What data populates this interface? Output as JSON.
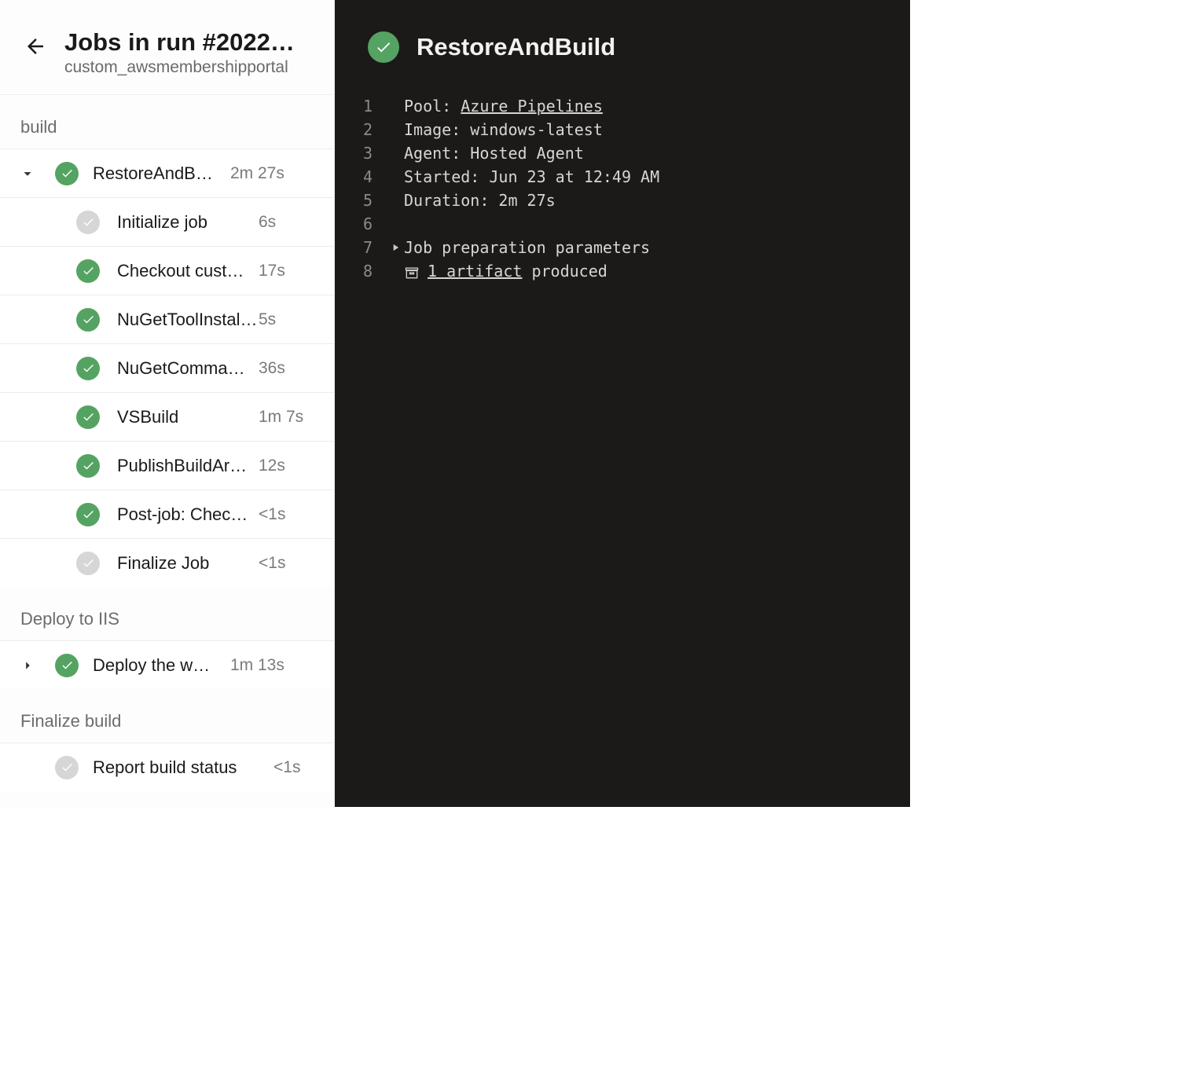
{
  "header": {
    "title": "Jobs in run #2022…",
    "subtitle": "custom_awsmembershipportal"
  },
  "stages": [
    {
      "name": "build",
      "jobs": [
        {
          "label": "RestoreAndB…",
          "duration": "2m 27s",
          "status": "success",
          "expanded": true,
          "steps": [
            {
              "label": "Initialize job",
              "duration": "6s",
              "status": "neutral"
            },
            {
              "label": "Checkout cust…",
              "duration": "17s",
              "status": "success"
            },
            {
              "label": "NuGetToolInstal…",
              "duration": "5s",
              "status": "success"
            },
            {
              "label": "NuGetComma…",
              "duration": "36s",
              "status": "success"
            },
            {
              "label": "VSBuild",
              "duration": "1m 7s",
              "status": "success"
            },
            {
              "label": "PublishBuildAr…",
              "duration": "12s",
              "status": "success"
            },
            {
              "label": "Post-job: Chec…",
              "duration": "<1s",
              "status": "success"
            },
            {
              "label": "Finalize Job",
              "duration": "<1s",
              "status": "neutral"
            }
          ]
        }
      ]
    },
    {
      "name": "Deploy to IIS",
      "jobs": [
        {
          "label": "Deploy the w…",
          "duration": "1m 13s",
          "status": "success",
          "expanded": false,
          "steps": []
        }
      ]
    },
    {
      "name": "Finalize build",
      "jobs": [
        {
          "label": "Report build status",
          "duration": "<1s",
          "status": "neutral",
          "no_chev": true,
          "expanded": false,
          "steps": []
        }
      ]
    }
  ],
  "main": {
    "title": "RestoreAndBuild",
    "status": "success",
    "log": {
      "pool_label": "Pool: ",
      "pool_link": "Azure Pipelines",
      "image_line": "Image: windows-latest",
      "agent_line": "Agent: Hosted Agent",
      "started_line": "Started: Jun 23 at 12:49 AM",
      "duration_line": "Duration: 2m 27s",
      "prep_line": "Job preparation parameters",
      "artifact_link": "1 artifact",
      "artifact_suffix": " produced"
    }
  }
}
